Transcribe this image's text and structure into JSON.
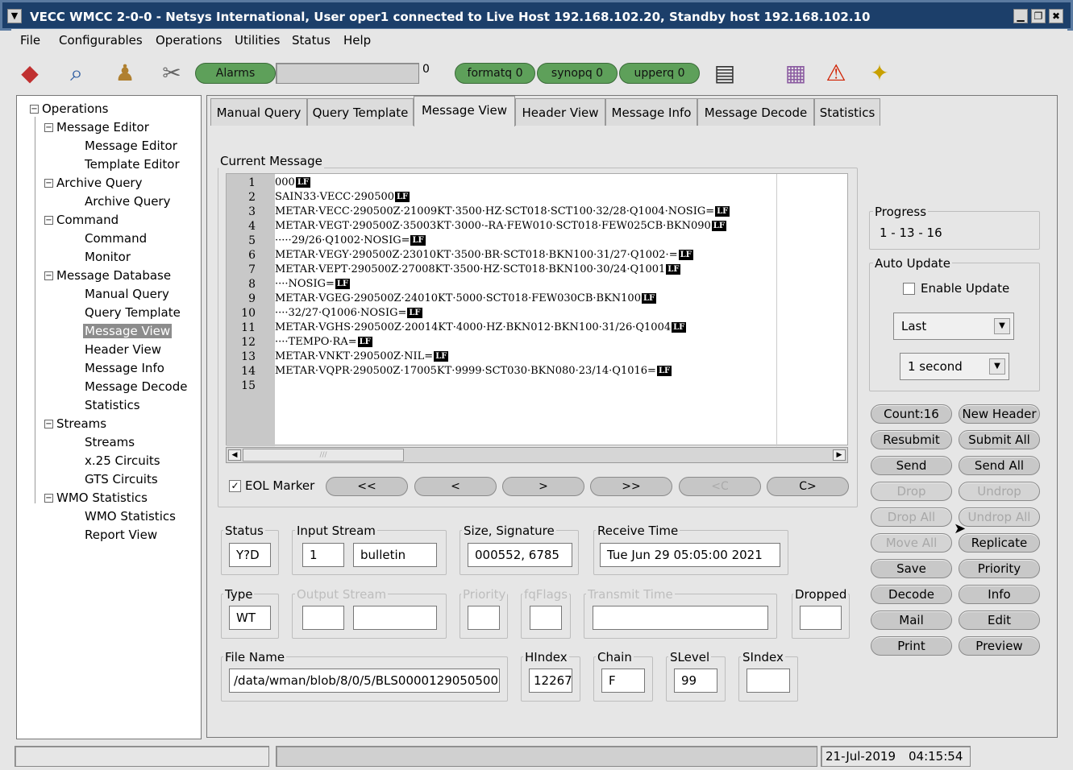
{
  "window": {
    "title": "VECC WMCC 2-0-0 - Netsys International, User oper1 connected to Live Host 192.168.102.20, Standby host 192.168.102.10",
    "minimize": "▁",
    "maximize": "❐",
    "close": "✖"
  },
  "menu": [
    "File",
    "Configurables",
    "Operations",
    "Utilities",
    "Status",
    "Help"
  ],
  "toolbar": {
    "alarms_label": "Alarms",
    "alarms_count": "0",
    "formatq": "formatq 0",
    "synopq": "synopq 0",
    "upperq": "upperq 0"
  },
  "tree": {
    "root": "Operations",
    "groups": [
      {
        "label": "Message Editor",
        "items": [
          "Message Editor",
          "Template Editor"
        ]
      },
      {
        "label": "Archive Query",
        "items": [
          "Archive Query"
        ]
      },
      {
        "label": "Command",
        "items": [
          "Command",
          "Monitor"
        ]
      },
      {
        "label": "Message Database",
        "items": [
          "Manual Query",
          "Query Template",
          "Message View",
          "Header View",
          "Message Info",
          "Message Decode",
          "Statistics"
        ]
      },
      {
        "label": "Streams",
        "items": [
          "Streams",
          "x.25 Circuits",
          "GTS Circuits"
        ]
      },
      {
        "label": "WMO Statistics",
        "items": [
          "WMO Statistics",
          "Report View"
        ]
      }
    ],
    "selected": "Message View"
  },
  "tabs": [
    "Manual Query",
    "Query Template",
    "Message View",
    "Header View",
    "Message Info",
    "Message Decode",
    "Statistics"
  ],
  "active_tab": "Message View",
  "current_message": {
    "label": "Current Message",
    "eol_tag": "LF",
    "lines": [
      "000",
      "SAIN33·VECC·290500",
      "METAR·VECC·290500Z·21009KT·3500·HZ·SCT018·SCT100·32/28·Q1004·NOSIG=",
      "METAR·VEGT·290500Z·35003KT·3000·-RA·FEW010·SCT018·FEW025CB·BKN090",
      "·····29/26·Q1002·NOSIG=",
      "METAR·VEGY·290500Z·23010KT·3500·BR·SCT018·BKN100·31/27·Q1002·=",
      "METAR·VEPT·290500Z·27008KT·3500·HZ·SCT018·BKN100·30/24·Q1001",
      "····NOSIG=",
      "METAR·VGEG·290500Z·24010KT·5000·SCT018·FEW030CB·BKN100",
      "····32/27·Q1006·NOSIG=",
      "METAR·VGHS·290500Z·20014KT·4000·HZ·BKN012·BKN100·31/26·Q1004",
      "····TEMPO·RA=",
      "METAR·VNKT·290500Z·NIL=",
      "METAR·VQPR·290500Z·17005KT·9999·SCT030·BKN080·23/14·Q1016=",
      ""
    ],
    "eol_marker_label": "EOL Marker",
    "nav": [
      "<<",
      "<",
      ">",
      ">>",
      "<C",
      "C>"
    ]
  },
  "progress": {
    "label": "Progress",
    "value": "1 - 13 - 16"
  },
  "auto_update": {
    "label": "Auto Update",
    "enable_label": "Enable Update",
    "mode": "Last",
    "interval": "1 second"
  },
  "actions": [
    [
      "Count:16",
      "New Header"
    ],
    [
      "Resubmit",
      "Submit All"
    ],
    [
      "Send",
      "Send All"
    ],
    [
      "Drop",
      "Undrop"
    ],
    [
      "Drop All",
      "Undrop All"
    ],
    [
      "Move All",
      "Replicate"
    ],
    [
      "Save",
      "Priority"
    ],
    [
      "Decode",
      "Info"
    ],
    [
      "Mail",
      "Edit"
    ],
    [
      "Print",
      "Preview"
    ]
  ],
  "fields": {
    "status_label": "Status",
    "status": "Y?D",
    "input_stream_label": "Input Stream",
    "input_stream_num": "1",
    "input_stream_name": "bulletin",
    "size_label": "Size, Signature",
    "size": "000552, 6785",
    "receive_label": "Receive Time",
    "receive": "Tue Jun 29 05:05:00 2021",
    "type_label": "Type",
    "type": "WT",
    "output_label": "Output Stream",
    "priority_label": "Priority",
    "fqflags_label": "fqFlags",
    "transmit_label": "Transmit Time",
    "dropped_label": "Dropped",
    "filename_label": "File Name",
    "filename": "/data/wman/blob/8/0/5/BLS0000129050500",
    "hindex_label": "HIndex",
    "hindex": "12267",
    "chain_label": "Chain",
    "chain": "F",
    "slevel_label": "SLevel",
    "slevel": "99",
    "sindex_label": "SIndex"
  },
  "statusbar": {
    "date": "21-Jul-2019",
    "time": "04:15:54"
  }
}
